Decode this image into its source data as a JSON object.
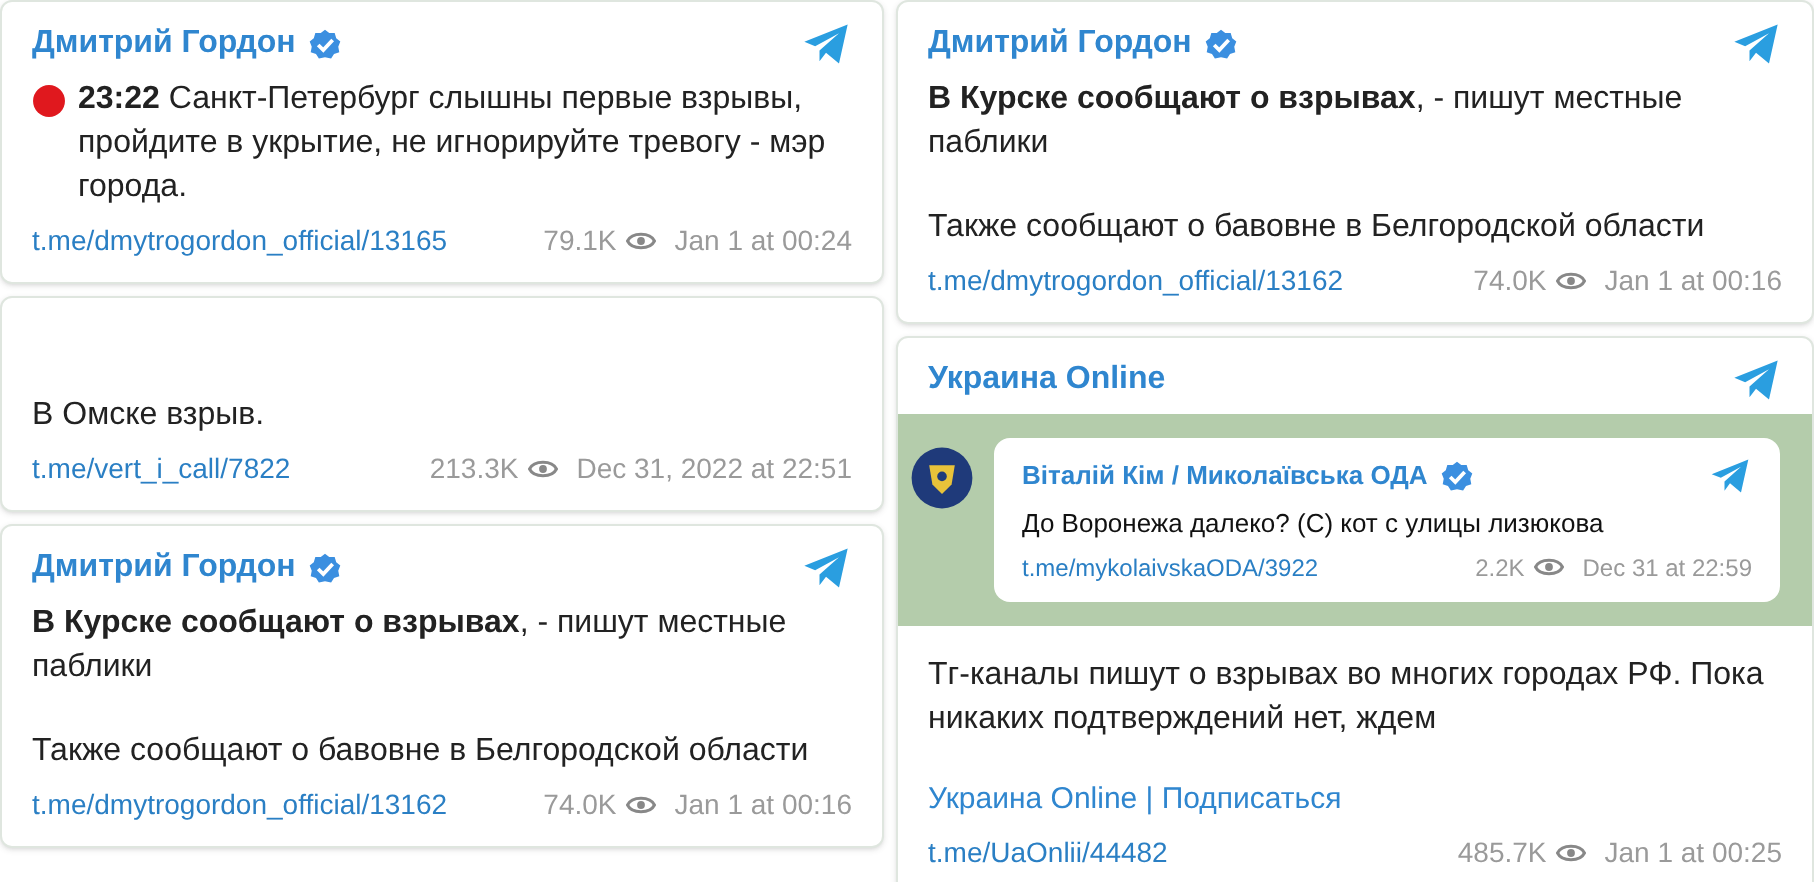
{
  "columns": [
    {
      "posts": [
        {
          "channel": "Дмитрий Гордон",
          "verified": true,
          "live_dot": true,
          "body": [
            "**23:22** Санкт-Петербург слышны первые взрывы, пройдите в укрытие, не игнорируйте тревогу - мэр города."
          ],
          "link": "t.me/dmytrogordon_official/13165",
          "views": "79.1K",
          "date": "Jan 1 at 00:24"
        },
        {
          "live_dot": false,
          "body": [
            "В Омске взрыв."
          ],
          "link": "t.me/vert_i_call/7822",
          "views": "213.3K",
          "date": "Dec 31, 2022 at 22:51"
        },
        {
          "channel": "Дмитрий Гордон",
          "verified": true,
          "live_dot": false,
          "body": [
            "**В Курске сообщают о взрывах**, - пишут местные паблики",
            "Также сообщают о бавовне в Белгородской области"
          ],
          "link": "t.me/dmytrogordon_official/13162",
          "views": "74.0K",
          "date": "Jan 1 at 00:16"
        }
      ]
    },
    {
      "posts": [
        {
          "channel": "Дмитрий Гордон",
          "verified": true,
          "live_dot": false,
          "body": [
            "**В Курске сообщают о взрывах**, - пишут местные паблики",
            "Также сообщают о бавовне в Белгородской области"
          ],
          "link": "t.me/dmytrogordon_official/13162",
          "views": "74.0K",
          "date": "Jan 1 at 00:16"
        },
        {
          "channel": "Украина Online",
          "verified": false,
          "live_dot": false,
          "embed": {
            "channel": "Віталій Кім / Миколаївська ОДА",
            "verified": true,
            "text": "До Воронежа далеко? (С) кот с улицы лизюкова",
            "link": "t.me/mykolaivskaODA/3922",
            "views": "2.2K",
            "date": "Dec 31 at 22:59"
          },
          "body": [
            "Тг-каналы пишут о взрывах во многих городах РФ. Пока никаких подтверждений нет, ждем"
          ],
          "signature": "Украина Online | Подписаться",
          "link": "t.me/UaOnlii/44482",
          "views": "485.7K",
          "date": "Jan 1 at 00:25"
        }
      ]
    }
  ]
}
